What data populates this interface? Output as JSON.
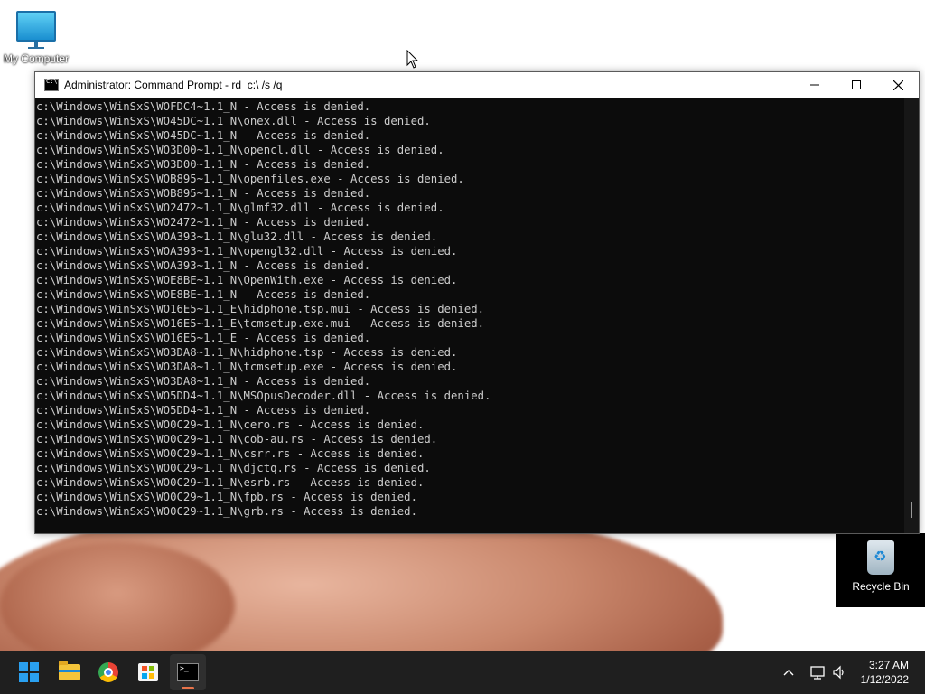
{
  "desktop": {
    "icons": [
      {
        "label": "My Computer",
        "icon": "monitor-icon"
      },
      {
        "label": "Recycle Bin",
        "icon": "recycle-bin-icon"
      }
    ]
  },
  "window": {
    "title": "Administrator: Command Prompt - rd  c:\\ /s /q",
    "icon": "cmd-icon",
    "controls": [
      "minimize-icon",
      "maximize-icon",
      "close-icon"
    ],
    "console_lines": [
      "c:\\Windows\\WinSxS\\WOFDC4~1.1_N - Access is denied.",
      "c:\\Windows\\WinSxS\\WO45DC~1.1_N\\onex.dll - Access is denied.",
      "c:\\Windows\\WinSxS\\WO45DC~1.1_N - Access is denied.",
      "c:\\Windows\\WinSxS\\WO3D00~1.1_N\\opencl.dll - Access is denied.",
      "c:\\Windows\\WinSxS\\WO3D00~1.1_N - Access is denied.",
      "c:\\Windows\\WinSxS\\WOB895~1.1_N\\openfiles.exe - Access is denied.",
      "c:\\Windows\\WinSxS\\WOB895~1.1_N - Access is denied.",
      "c:\\Windows\\WinSxS\\WO2472~1.1_N\\glmf32.dll - Access is denied.",
      "c:\\Windows\\WinSxS\\WO2472~1.1_N - Access is denied.",
      "c:\\Windows\\WinSxS\\WOA393~1.1_N\\glu32.dll - Access is denied.",
      "c:\\Windows\\WinSxS\\WOA393~1.1_N\\opengl32.dll - Access is denied.",
      "c:\\Windows\\WinSxS\\WOA393~1.1_N - Access is denied.",
      "c:\\Windows\\WinSxS\\WOE8BE~1.1_N\\OpenWith.exe - Access is denied.",
      "c:\\Windows\\WinSxS\\WOE8BE~1.1_N - Access is denied.",
      "c:\\Windows\\WinSxS\\WO16E5~1.1_E\\hidphone.tsp.mui - Access is denied.",
      "c:\\Windows\\WinSxS\\WO16E5~1.1_E\\tcmsetup.exe.mui - Access is denied.",
      "c:\\Windows\\WinSxS\\WO16E5~1.1_E - Access is denied.",
      "c:\\Windows\\WinSxS\\WO3DA8~1.1_N\\hidphone.tsp - Access is denied.",
      "c:\\Windows\\WinSxS\\WO3DA8~1.1_N\\tcmsetup.exe - Access is denied.",
      "c:\\Windows\\WinSxS\\WO3DA8~1.1_N - Access is denied.",
      "c:\\Windows\\WinSxS\\WO5DD4~1.1_N\\MSOpusDecoder.dll - Access is denied.",
      "c:\\Windows\\WinSxS\\WO5DD4~1.1_N - Access is denied.",
      "c:\\Windows\\WinSxS\\WO0C29~1.1_N\\cero.rs - Access is denied.",
      "c:\\Windows\\WinSxS\\WO0C29~1.1_N\\cob-au.rs - Access is denied.",
      "c:\\Windows\\WinSxS\\WO0C29~1.1_N\\csrr.rs - Access is denied.",
      "c:\\Windows\\WinSxS\\WO0C29~1.1_N\\djctq.rs - Access is denied.",
      "c:\\Windows\\WinSxS\\WO0C29~1.1_N\\esrb.rs - Access is denied.",
      "c:\\Windows\\WinSxS\\WO0C29~1.1_N\\fpb.rs - Access is denied.",
      "c:\\Windows\\WinSxS\\WO0C29~1.1_N\\grb.rs - Access is denied."
    ]
  },
  "taskbar": {
    "items": [
      "start-icon",
      "file-explorer-icon",
      "chrome-icon",
      "store-icon",
      "command-prompt-icon"
    ],
    "tray_icons": [
      "chevron-up-icon",
      "network-icon",
      "volume-icon"
    ],
    "time": "3:27 AM",
    "date": "1/12/2022"
  }
}
